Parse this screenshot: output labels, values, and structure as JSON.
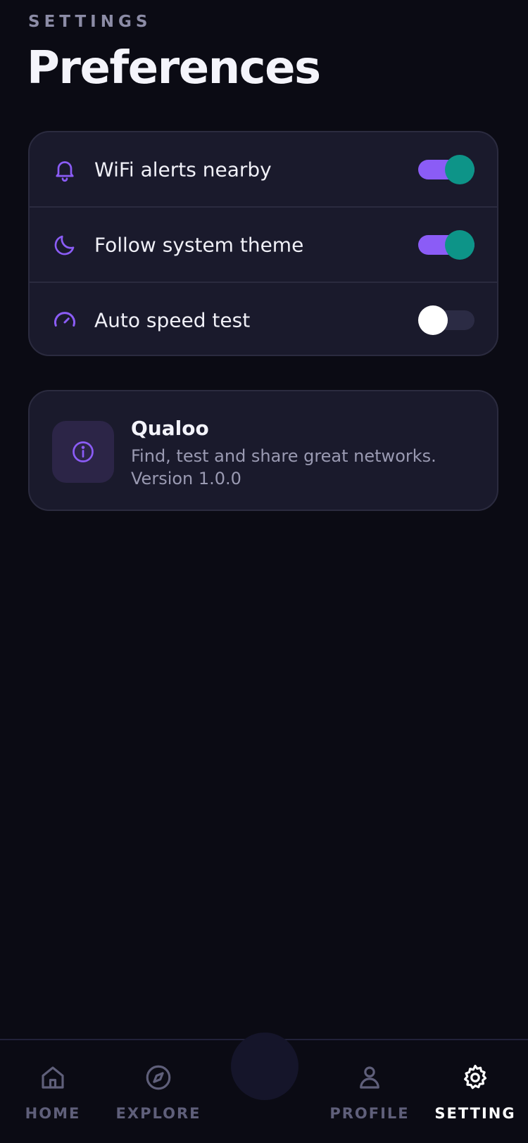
{
  "header": {
    "overline": "SETTINGS",
    "title": "Preferences"
  },
  "preferences": [
    {
      "label": "WiFi alerts nearby",
      "icon": "bell-icon",
      "enabled": true
    },
    {
      "label": "Follow system theme",
      "icon": "moon-icon",
      "enabled": true
    },
    {
      "label": "Auto speed test",
      "icon": "gauge-icon",
      "enabled": false
    }
  ],
  "about": {
    "icon": "info-icon",
    "app_name": "Qualoo",
    "description": "Find, test and share great networks.",
    "version": "Version 1.0.0"
  },
  "nav": {
    "items": [
      {
        "label": "HOME",
        "icon": "home-icon",
        "active": false
      },
      {
        "label": "EXPLORE",
        "icon": "compass-icon",
        "active": false
      },
      {
        "label": "PROFILE",
        "icon": "user-icon",
        "active": false
      },
      {
        "label": "SETTING",
        "icon": "gear-icon",
        "active": true
      }
    ]
  },
  "colors": {
    "background": "#0b0b14",
    "card": "#1a1a2c",
    "accent": "#8b5cf6",
    "toggle_knob_on": "#0d9488"
  }
}
